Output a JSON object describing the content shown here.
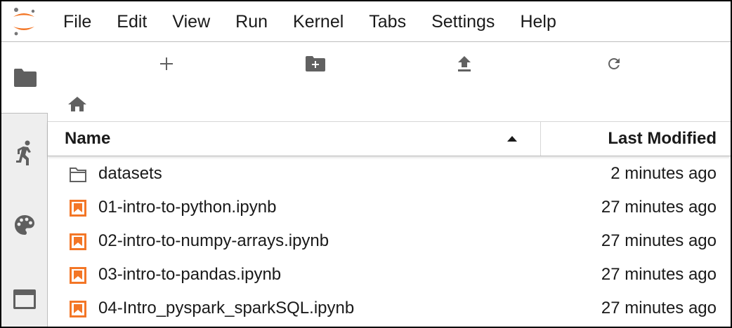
{
  "menubar": {
    "logo": "jupyter-logo-icon",
    "items": [
      "File",
      "Edit",
      "View",
      "Run",
      "Kernel",
      "Tabs",
      "Settings",
      "Help"
    ]
  },
  "sidebar": {
    "tabs": [
      {
        "icon": "folder-icon",
        "active": true
      },
      {
        "icon": "running-icon",
        "active": false
      },
      {
        "icon": "palette-icon",
        "active": false
      },
      {
        "icon": "tabs-icon",
        "active": false
      }
    ]
  },
  "toolbar": {
    "buttons": [
      "new-launcher-icon",
      "new-folder-icon",
      "upload-icon",
      "refresh-icon"
    ]
  },
  "breadcrumb": {
    "icon": "home-icon"
  },
  "file_list": {
    "headers": {
      "name": "Name",
      "modified": "Last Modified"
    },
    "sort": "ascending",
    "rows": [
      {
        "type": "folder",
        "icon": "folder-outline-icon",
        "name": "datasets",
        "modified": "2 minutes ago"
      },
      {
        "type": "notebook",
        "icon": "notebook-icon",
        "name": "01-intro-to-python.ipynb",
        "modified": "27 minutes ago"
      },
      {
        "type": "notebook",
        "icon": "notebook-icon",
        "name": "02-intro-to-numpy-arrays.ipynb",
        "modified": "27 minutes ago"
      },
      {
        "type": "notebook",
        "icon": "notebook-icon",
        "name": "03-intro-to-pandas.ipynb",
        "modified": "27 minutes ago"
      },
      {
        "type": "notebook",
        "icon": "notebook-icon",
        "name": "04-Intro_pyspark_sparkSQL.ipynb",
        "modified": "27 minutes ago"
      }
    ]
  },
  "colors": {
    "accent": "#F37626",
    "icon_gray": "#616161",
    "sidebar_bg": "#EEEEEE"
  }
}
